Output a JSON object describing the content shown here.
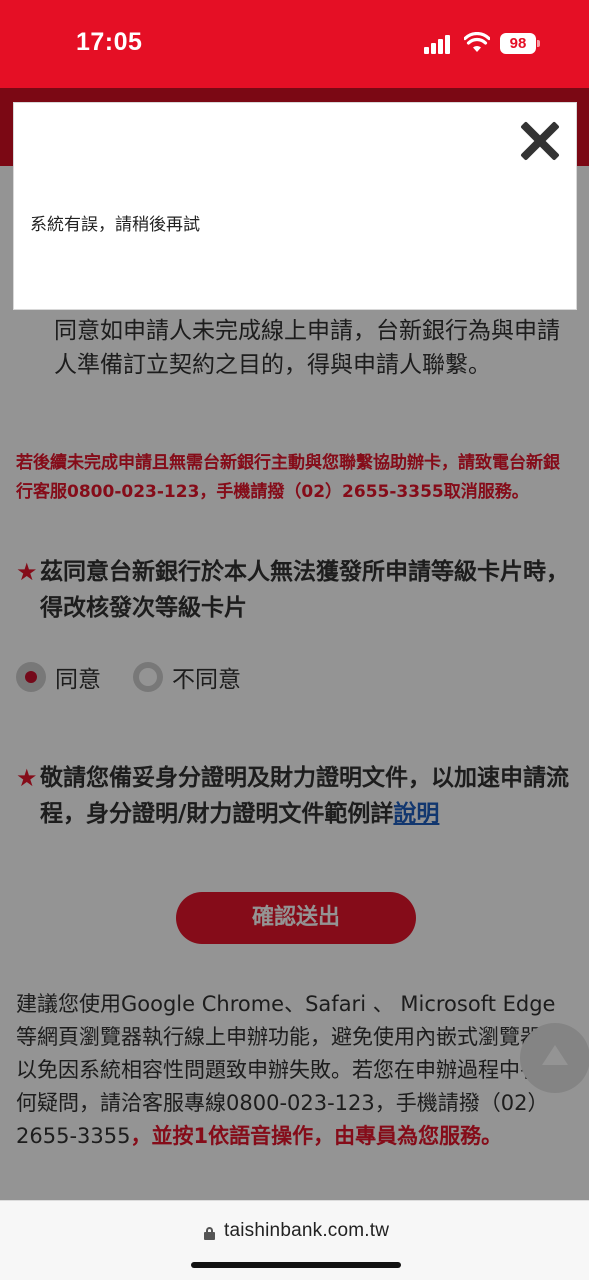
{
  "status_bar": {
    "time": "17:05",
    "battery": "98",
    "icons": [
      "signal-icon",
      "wifi-icon",
      "battery-icon"
    ]
  },
  "consent": {
    "text": "同意如申請人未完成線上申請，台新銀行為與申請人準備訂立契約之目的，得與申請人聯繫。"
  },
  "notice": {
    "text": "若後續未完成申請且無需台新銀行主動與您聯繫協助辦卡，請致電台新銀行客服0800-023-123，手機請撥（02）2655-3355取消服務。"
  },
  "question1": {
    "star": "★",
    "text": "茲同意台新銀行於本人無法獲發所申請等級卡片時，得改核發次等級卡片",
    "options": [
      {
        "label": "同意",
        "checked": true
      },
      {
        "label": "不同意",
        "checked": false
      }
    ]
  },
  "question2": {
    "star": "★",
    "text": "敬請您備妥身分證明及財力證明文件，以加速申請流程，身分證明/財力證明文件範例詳",
    "link": "說明"
  },
  "confirm_button": "確認送出",
  "browser_note": {
    "text": "建議您使用Google Chrome、Safari 、 Microsoft Edge等網頁瀏覽器執行線上申辦功能，避免使用內嵌式瀏覽器，以免因系統相容性問題致申辦失敗。若您在申辦過程中有任何疑問，請洽客服專線0800-023-123，手機請撥（02）2655-3355",
    "highlight": "，並按1依語音操作，由專員為您服務。"
  },
  "modal": {
    "message": "系統有誤，請稍後再試",
    "close_icon": "close-icon"
  },
  "browser_bar": {
    "url": "taishinbank.com.tw"
  },
  "colors": {
    "brand_red": "#e50f25",
    "text": "#333333",
    "link": "#1f5fbf"
  }
}
